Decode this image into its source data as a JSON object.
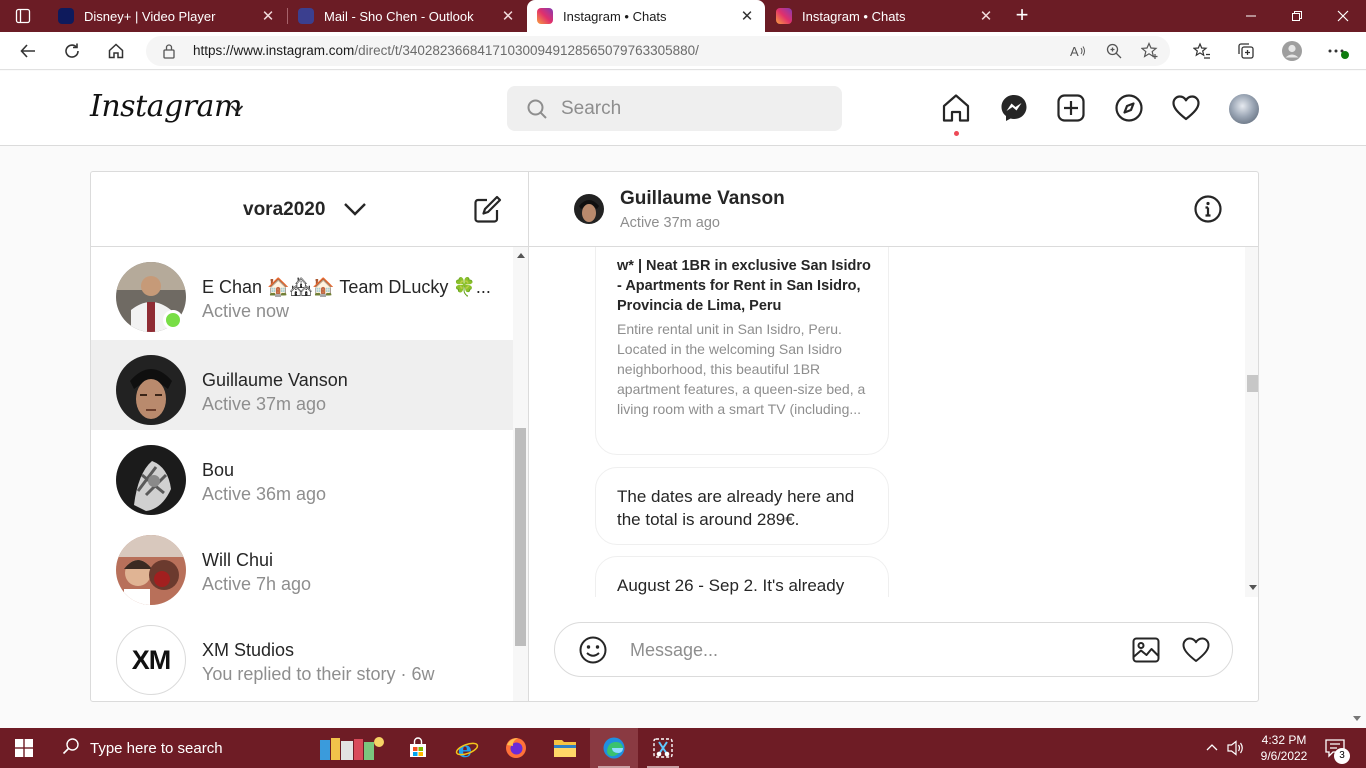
{
  "browser": {
    "tabs": [
      {
        "title": "Disney+ | Video Player",
        "active": false
      },
      {
        "title": "Mail - Sho Chen - Outlook",
        "active": false
      },
      {
        "title": "Instagram • Chats",
        "active": true
      },
      {
        "title": "Instagram • Chats",
        "active": false
      }
    ],
    "url": "https://www.instagram.com/direct/t/340282366841710300949128565079763305880/",
    "url_host": "https://www.instagram.com",
    "url_path": "/direct/t/340282366841710300949128565079763305880/",
    "close_glyph": "✕",
    "new_tab_glyph": "+"
  },
  "instagram": {
    "logo": "Instagram",
    "search_placeholder": "Search",
    "colors": {
      "notification_dot": "#ed4956",
      "online": "#78de45",
      "selected_row": "#efefef"
    }
  },
  "inbox": {
    "account": "vora2020",
    "threads": [
      {
        "name": "E Chan 🏠🏘🏠 Team DLucky 🍀...",
        "status": "Active now",
        "online": true,
        "selected": false
      },
      {
        "name": "Guillaume Vanson",
        "status": "Active 37m ago",
        "online": false,
        "selected": true
      },
      {
        "name": "Bou",
        "status": "Active 36m ago",
        "online": false,
        "selected": false
      },
      {
        "name": "Will Chui",
        "status": "Active 7h ago",
        "online": false,
        "selected": false
      },
      {
        "name": "XM Studios",
        "status": "You replied to their story · 6w",
        "online": false,
        "selected": false,
        "avatar_text": "XM"
      }
    ]
  },
  "chat": {
    "name": "Guillaume Vanson",
    "active": "Active 37m ago",
    "link_preview": {
      "title": "w* | Neat 1BR in exclusive San Isidro - Apartments for Rent in San Isidro, Provincia de Lima, Peru",
      "description": "Entire rental unit in San Isidro, Peru. Located in the welcoming San Isidro neighborhood, this beautiful 1BR apartment features, a queen-size bed, a living room with a smart TV (including..."
    },
    "messages": [
      "The dates are already here and the total is around 289€.",
      "August 26 - Sep 2. It's already"
    ],
    "composer_placeholder": "Message..."
  },
  "taskbar": {
    "search_text": "Type here to search",
    "time": "4:32 PM",
    "date": "9/6/2022",
    "notification_count": "3"
  }
}
